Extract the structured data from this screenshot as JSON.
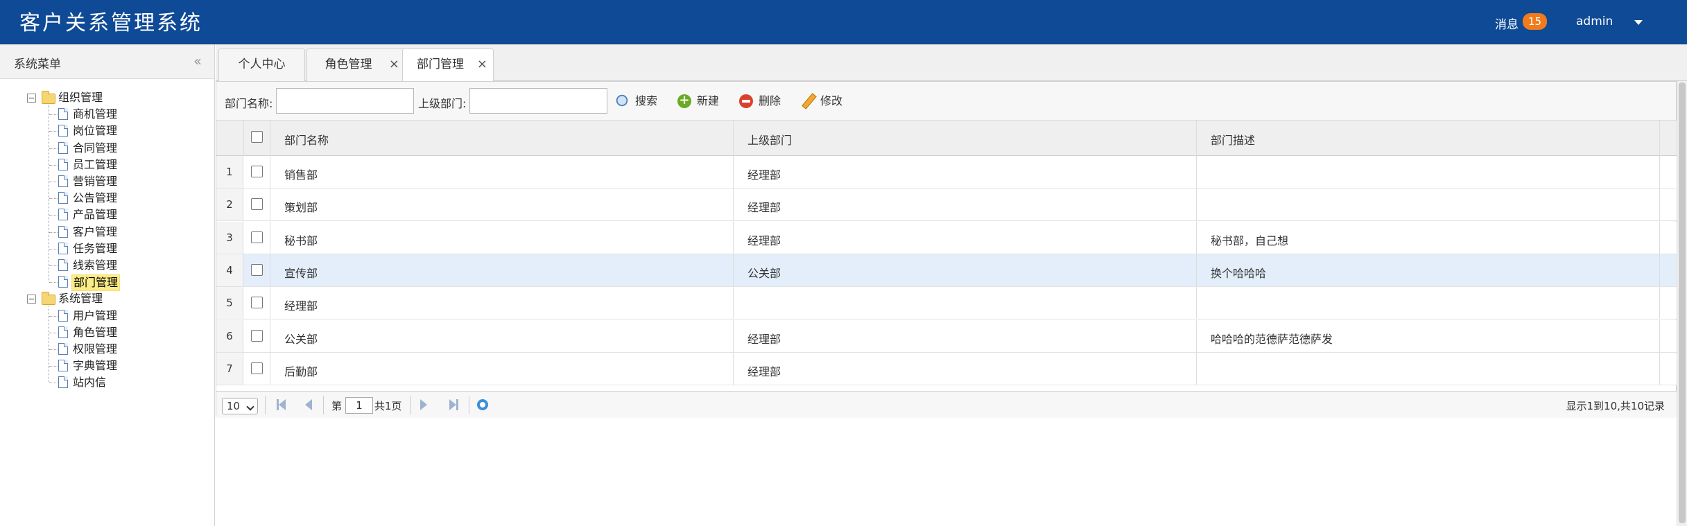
{
  "app": {
    "title": "客户关系管理系统"
  },
  "header": {
    "messages_label": "消息",
    "messages_count": "15",
    "user": "admin"
  },
  "sidebar": {
    "title": "系统菜单",
    "groups": [
      {
        "label": "组织管理",
        "items": [
          "商机管理",
          "岗位管理",
          "合同管理",
          "员工管理",
          "营销管理",
          "公告管理",
          "产品管理",
          "客户管理",
          "任务管理",
          "线索管理",
          "部门管理"
        ]
      },
      {
        "label": "系统管理",
        "items": [
          "用户管理",
          "角色管理",
          "权限管理",
          "字典管理",
          "站内信"
        ]
      }
    ],
    "selected": "部门管理"
  },
  "tabs": [
    {
      "label": "个人中心",
      "closable": false
    },
    {
      "label": "角色管理",
      "closable": true
    },
    {
      "label": "部门管理",
      "closable": true,
      "active": true
    }
  ],
  "toolbar": {
    "dept_name_label": "部门名称:",
    "dept_name_value": "",
    "parent_label": "上级部门:",
    "parent_value": "",
    "search": "搜索",
    "add": "新建",
    "delete": "删除",
    "edit": "修改"
  },
  "grid": {
    "columns": [
      "部门名称",
      "上级部门",
      "部门描述"
    ],
    "rows": [
      {
        "num": "1",
        "name": "销售部",
        "parent": "经理部",
        "desc": ""
      },
      {
        "num": "2",
        "name": "策划部",
        "parent": "经理部",
        "desc": ""
      },
      {
        "num": "3",
        "name": "秘书部",
        "parent": "经理部",
        "desc": "秘书部，自己想"
      },
      {
        "num": "4",
        "name": "宣传部",
        "parent": "公关部",
        "desc": "换个哈哈哈"
      },
      {
        "num": "5",
        "name": "经理部",
        "parent": "",
        "desc": ""
      },
      {
        "num": "6",
        "name": "公关部",
        "parent": "经理部",
        "desc": "哈哈哈的范德萨范德萨发"
      },
      {
        "num": "7",
        "name": "后勤部",
        "parent": "经理部",
        "desc": ""
      }
    ],
    "highlighted_row": 4
  },
  "pager": {
    "page_size": "10",
    "page_prefix": "第",
    "page_value": "1",
    "page_suffix": "共1页",
    "summary": "显示1到10,共10记录"
  }
}
